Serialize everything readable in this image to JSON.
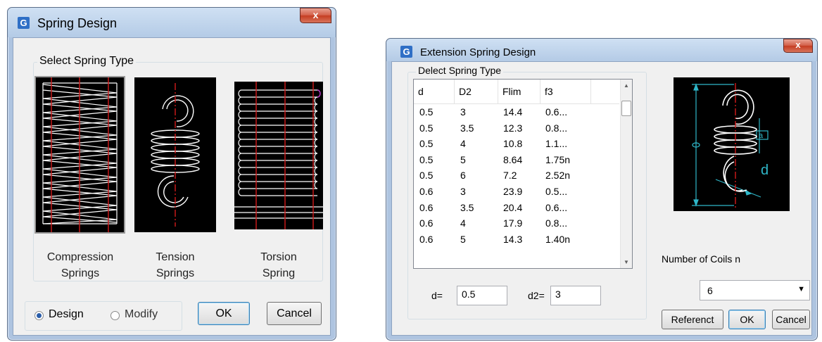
{
  "dialog1": {
    "title": "Spring Design",
    "close_label": "x",
    "group_label": "Select Spring Type",
    "springs": [
      {
        "line1": "Compression",
        "line2": "Springs"
      },
      {
        "line1": "Tension",
        "line2": "Springs"
      },
      {
        "line1": "Torsion",
        "line2": "Spring"
      }
    ],
    "mode_design": "Design",
    "mode_modify": "Modify",
    "selected_mode": "Design",
    "ok_label": "OK",
    "cancel_label": "Cancel"
  },
  "dialog2": {
    "title": "Extension Spring Design",
    "close_label": "x",
    "group_label": "Delect Spring Type",
    "columns": [
      "d",
      "D2",
      "Flim",
      "f3"
    ],
    "rows": [
      [
        "0.5",
        "3",
        "14.4",
        "0.6..."
      ],
      [
        "0.5",
        "3.5",
        "12.3",
        "0.8..."
      ],
      [
        "0.5",
        "4",
        "10.8",
        "1.1..."
      ],
      [
        "0.5",
        "5",
        "8.64",
        "1.75n"
      ],
      [
        "0.5",
        "6",
        "7.2",
        "2.52n"
      ],
      [
        "0.6",
        "3",
        "23.9",
        "0.5..."
      ],
      [
        "0.6",
        "3.5",
        "20.4",
        "0.6..."
      ],
      [
        "0.6",
        "4",
        "17.9",
        "0.8..."
      ],
      [
        "0.6",
        "5",
        "14.3",
        "1.40n"
      ]
    ],
    "d_label": "d=",
    "d_value": "0.5",
    "d2_label": "d2=",
    "d2_value": "3",
    "coils_label": "Number of Coils n",
    "coils_value": "6",
    "referenct_label": "Referenct",
    "ok_label": "OK",
    "cancel_label": "Cancel",
    "diagram_label_d": "d",
    "diagram_label_a": "a"
  }
}
